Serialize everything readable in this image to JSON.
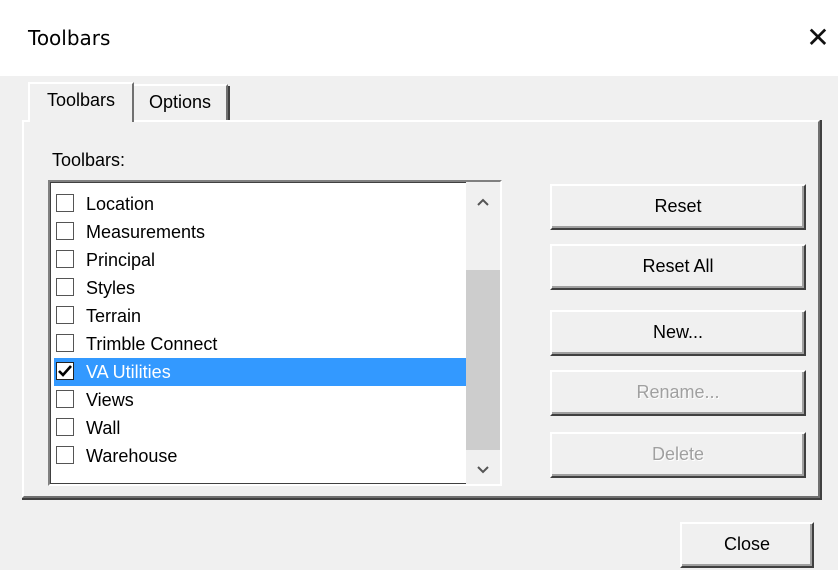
{
  "window": {
    "title": "Toolbars",
    "close_glyph": "✕"
  },
  "tabs": [
    {
      "label": "Toolbars",
      "active": true
    },
    {
      "label": "Options",
      "active": false
    }
  ],
  "toolbars_label": "Toolbars:",
  "list": {
    "items": [
      {
        "label": "Location",
        "checked": false,
        "selected": false
      },
      {
        "label": "Measurements",
        "checked": false,
        "selected": false
      },
      {
        "label": "Principal",
        "checked": false,
        "selected": false
      },
      {
        "label": "Styles",
        "checked": false,
        "selected": false
      },
      {
        "label": "Terrain",
        "checked": false,
        "selected": false
      },
      {
        "label": "Trimble Connect",
        "checked": false,
        "selected": false
      },
      {
        "label": "VA Utilities",
        "checked": true,
        "selected": true
      },
      {
        "label": "Views",
        "checked": false,
        "selected": false
      },
      {
        "label": "Wall",
        "checked": false,
        "selected": false
      },
      {
        "label": "Warehouse",
        "checked": false,
        "selected": false
      }
    ],
    "scroll_up_glyph": "⌃",
    "scroll_down_glyph": "⌄"
  },
  "buttons": {
    "reset": {
      "label": "Reset",
      "enabled": true
    },
    "reset_all": {
      "label": "Reset All",
      "enabled": true
    },
    "new": {
      "label": "New...",
      "enabled": true
    },
    "rename": {
      "label": "Rename...",
      "enabled": false
    },
    "delete": {
      "label": "Delete",
      "enabled": false
    },
    "close": {
      "label": "Close",
      "enabled": true
    }
  },
  "colors": {
    "selection": "#3399ff",
    "dialog_bg": "#f0f0f0",
    "disabled_text": "#a0a0a0"
  }
}
